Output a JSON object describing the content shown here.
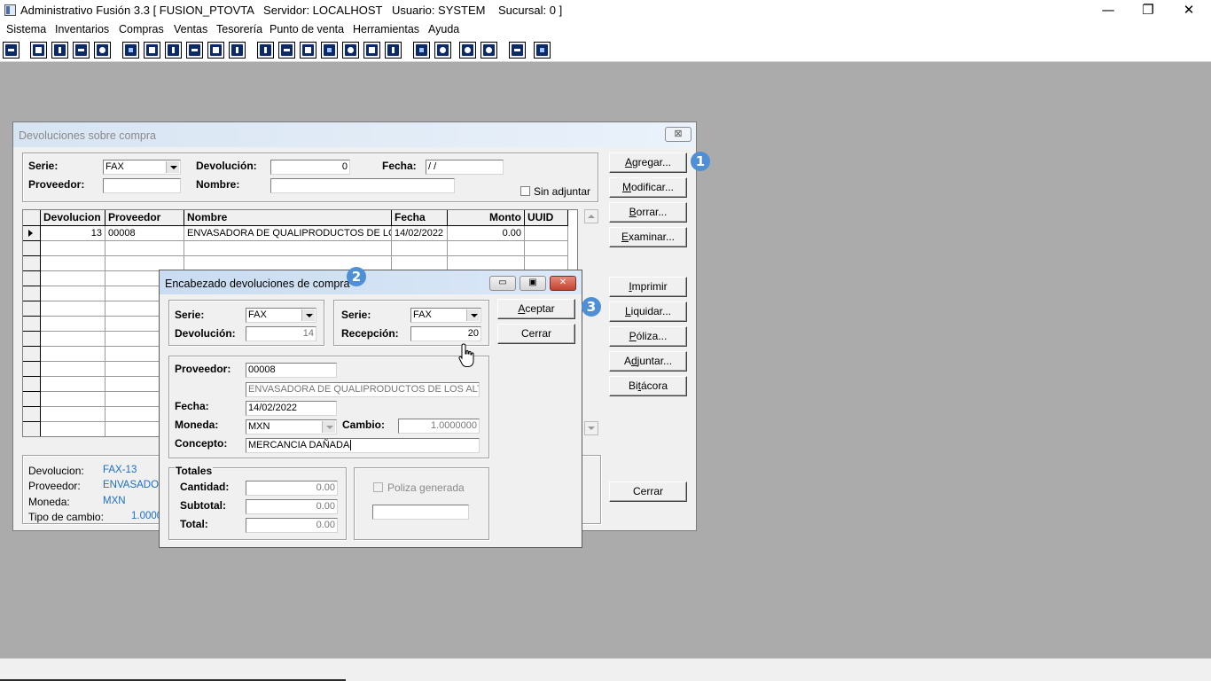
{
  "app": {
    "title": "Administrativo Fusión 3.3 [ FUSION_PTOVTA   Servidor: LOCALHOST   Usuario: SYSTEM    Sucursal: 0 ]"
  },
  "window_controls": {
    "minimize": "—",
    "restore": "❐",
    "close": "✕"
  },
  "menu": [
    "Sistema",
    "Inventarios",
    "Compras",
    "Ventas",
    "Tesorería",
    "Punto de venta",
    "Herramientas",
    "Ayuda"
  ],
  "toolbar_icons": [
    "calculator-icon",
    "document-icon",
    "clipboard-icon",
    "transfer-icon",
    "search-icon",
    "user-icon",
    "folder-icon",
    "import-icon",
    "print-icon",
    "page-icon",
    "list-icon",
    "pillars-icon",
    "box-icon",
    "export-icon",
    "add-icon",
    "money-icon",
    "report-icon",
    "table-icon",
    "home-icon",
    "zoom-icon",
    "refresh-icon",
    "undo-icon",
    "back-icon",
    "help-icon"
  ],
  "main_window": {
    "title": "Devoluciones sobre compra",
    "filter": {
      "serie_label": "Serie:",
      "serie_value": "FAX",
      "devolucion_label": "Devolución:",
      "devolucion_value": "0",
      "fecha_label": "Fecha:",
      "fecha_value": " / /",
      "proveedor_label": "Proveedor:",
      "proveedor_value": "",
      "nombre_label": "Nombre:",
      "nombre_value": "",
      "sin_adjuntar_label": "Sin adjuntar"
    },
    "grid": {
      "columns": [
        "Devolucion",
        "Proveedor",
        "Nombre",
        "Fecha",
        "Monto",
        "UUID"
      ],
      "rows": [
        {
          "devolucion": "13",
          "proveedor": "00008",
          "nombre": "ENVASADORA DE QUALIPRODUCTOS DE LOS A",
          "fecha": "14/02/2022",
          "monto": "0.00",
          "uuid": ""
        }
      ]
    },
    "buttons": {
      "agregar": {
        "pre": "",
        "key": "A",
        "post": "gregar..."
      },
      "modificar": {
        "pre": "",
        "key": "M",
        "post": "odificar..."
      },
      "borrar": {
        "pre": "",
        "key": "B",
        "post": "orrar..."
      },
      "examinar": {
        "pre": "",
        "key": "E",
        "post": "xaminar..."
      },
      "imprimir": {
        "pre": "",
        "key": "I",
        "post": "mprimir"
      },
      "liquidar": {
        "pre": "",
        "key": "L",
        "post": "iquidar..."
      },
      "poliza": {
        "pre": "",
        "key": "P",
        "post": "óliza..."
      },
      "adjuntar": {
        "pre": "A",
        "key": "d",
        "post": "juntar..."
      },
      "bitacora": {
        "pre": "Bi",
        "key": "t",
        "post": "ácora"
      },
      "cerrar": "Cerrar"
    },
    "info": {
      "devolucion_label": "Devolucion:",
      "devolucion_value": "FAX-13",
      "proveedor_label": "Proveedor:",
      "proveedor_value": "ENVASADORA",
      "moneda_label": "Moneda:",
      "moneda_value": "MXN",
      "tipo_cambio_label": "Tipo de cambio:",
      "tipo_cambio_value": "1.0000"
    }
  },
  "dialog": {
    "title": "Encabezado devoluciones de compra",
    "serie1_label": "Serie:",
    "serie1_value": "FAX",
    "devolucion_label": "Devolución:",
    "devolucion_value": "14",
    "serie2_label": "Serie:",
    "serie2_value": "FAX",
    "recepcion_label": "Recepción:",
    "recepcion_value": "20",
    "proveedor_label": "Proveedor:",
    "proveedor_value": "00008",
    "proveedor_nombre": "ENVASADORA DE QUALIPRODUCTOS DE LOS ALTOS S",
    "fecha_label": "Fecha:",
    "fecha_value": "14/02/2022",
    "moneda_label": "Moneda:",
    "moneda_value": "MXN",
    "cambio_label": "Cambio:",
    "cambio_value": "1.0000000",
    "concepto_label": "Concepto:",
    "concepto_value": "MERCANCIA DAÑADA",
    "totales_label": "Totales",
    "cantidad_label": "Cantidad:",
    "cantidad_value": "0.00",
    "subtotal_label": "Subtotal:",
    "subtotal_value": "0.00",
    "total_label": "Total:",
    "total_value": "0.00",
    "poliza_generada_label": "Poliza generada",
    "poliza_value": "",
    "aceptar": {
      "key": "A",
      "post": "ceptar"
    },
    "cerrar": "Cerrar"
  },
  "badges": [
    "1",
    "2",
    "3"
  ]
}
